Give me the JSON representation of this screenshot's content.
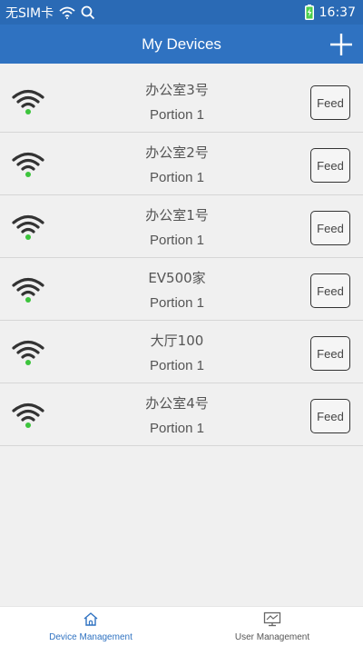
{
  "status_bar": {
    "carrier": "无SIM卡",
    "time": "16:37"
  },
  "header": {
    "title": "My Devices"
  },
  "devices": [
    {
      "name": "办公室3号",
      "portion": "Portion 1",
      "feed_label": "Feed"
    },
    {
      "name": "办公室2号",
      "portion": "Portion 1",
      "feed_label": "Feed"
    },
    {
      "name": "办公室1号",
      "portion": "Portion 1",
      "feed_label": "Feed"
    },
    {
      "name": "EV500家",
      "portion": "Portion 1",
      "feed_label": "Feed"
    },
    {
      "name": "大厅100",
      "portion": "Portion 1",
      "feed_label": "Feed"
    },
    {
      "name": "办公室4号",
      "portion": "Portion 1",
      "feed_label": "Feed"
    }
  ],
  "bottom_nav": {
    "device_management": "Device Management",
    "user_management": "User Management"
  },
  "colors": {
    "header_bg": "#2f72c1",
    "status_bar_bg": "#2a6ab5",
    "wifi_online_dot": "#3cc43c",
    "active_nav": "#2f72c1"
  },
  "icons": {
    "add": "plus-icon",
    "wifi": "wifi-icon",
    "search": "search-icon",
    "battery": "battery-charging-icon",
    "home": "home-icon",
    "user_mgmt": "monitor-chart-icon"
  }
}
